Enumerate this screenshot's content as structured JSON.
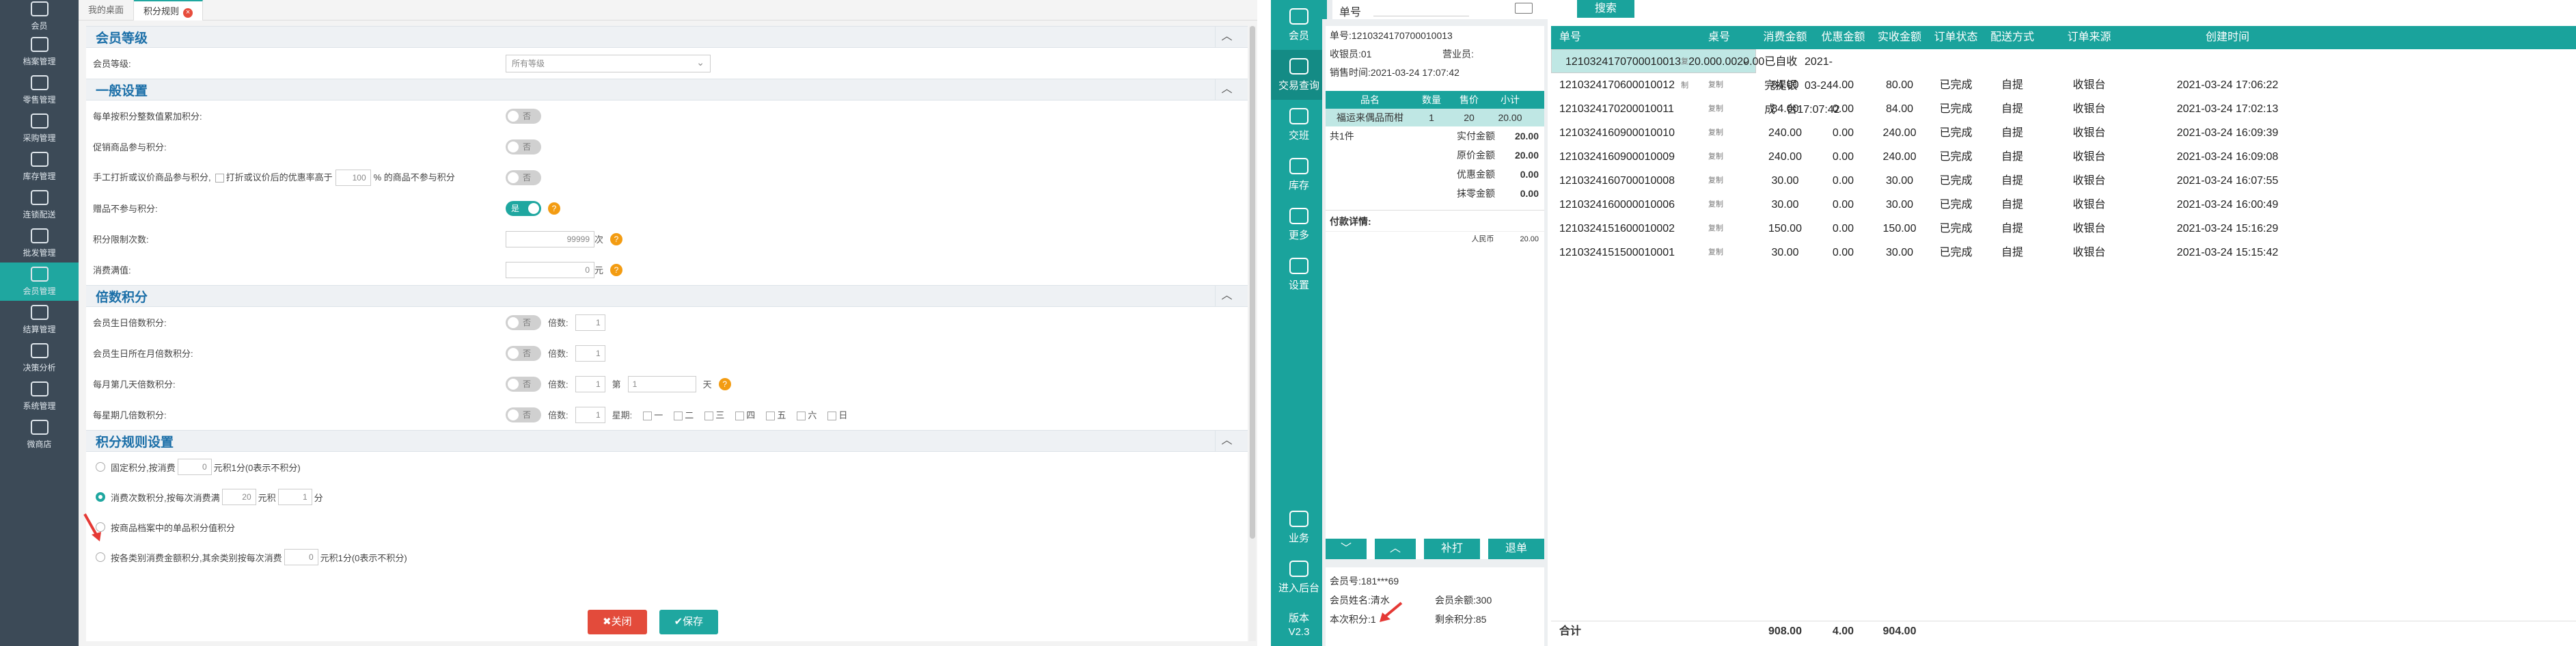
{
  "left_app": {
    "sidebar": [
      {
        "label": "会员",
        "icon": "people-icon"
      },
      {
        "label": "档案管理",
        "icon": "file-icon"
      },
      {
        "label": "零售管理",
        "icon": "shop-icon"
      },
      {
        "label": "采购管理",
        "icon": "cart-icon"
      },
      {
        "label": "库存管理",
        "icon": "box-icon"
      },
      {
        "label": "连锁配送",
        "icon": "truck-icon"
      },
      {
        "label": "批发管理",
        "icon": "wholesale-icon"
      },
      {
        "label": "会员管理",
        "icon": "user-icon",
        "active": true
      },
      {
        "label": "结算管理",
        "icon": "settle-icon"
      },
      {
        "label": "决策分析",
        "icon": "chart-icon"
      },
      {
        "label": "系统管理",
        "icon": "gear-icon"
      },
      {
        "label": "微商店",
        "icon": "store-icon"
      }
    ],
    "tabs": [
      {
        "label": "我的桌面"
      },
      {
        "label": "积分规则",
        "active": true,
        "close": "×"
      }
    ],
    "sections": {
      "member_level": {
        "title": "会员等级",
        "collapse": "︿",
        "level_label": "会员等级:",
        "level_value": "所有等级"
      },
      "general": {
        "title": "一般设置",
        "collapse": "︿",
        "rows": [
          {
            "label": "每单按积分整数值累加积分:",
            "toggle": "否",
            "on": false
          },
          {
            "label": "促销商品参与积分:",
            "toggle": "否",
            "on": false
          },
          {
            "label_a": "手工打折或议价商品参与积分,",
            "label_b": "打折或议价后的优惠率高于",
            "value": "100",
            "label_c": "% 的商品不参与积分",
            "toggle": "否",
            "on": false
          },
          {
            "label": "赠品不参与积分:",
            "toggle": "是",
            "on": true
          },
          {
            "label": "积分限制次数:",
            "value": "99999",
            "unit": "次"
          },
          {
            "label": "消费满值:",
            "value": "0",
            "unit": "元"
          }
        ]
      },
      "multiple": {
        "title": "倍数积分",
        "collapse": "︿",
        "rows": [
          {
            "label": "会员生日倍数积分:",
            "toggle": "否",
            "times_label": "倍数:",
            "times": "1"
          },
          {
            "label": "会员生日所在月倍数积分:",
            "toggle": "否",
            "times_label": "倍数:",
            "times": "1"
          },
          {
            "label": "每月第几天倍数积分:",
            "toggle": "否",
            "times_label": "倍数:",
            "times": "1",
            "day_label": "第",
            "day": "1",
            "day_unit": "天"
          },
          {
            "label": "每星期几倍数积分:",
            "toggle": "否",
            "times_label": "倍数:",
            "times": "1",
            "week_label": "星期:",
            "weekdays": [
              "一",
              "二",
              "三",
              "四",
              "五",
              "六",
              "日"
            ]
          }
        ]
      },
      "rule": {
        "title": "积分规则设置",
        "collapse": "︿",
        "options": [
          {
            "pre": "固定积分,按消费",
            "value": "0",
            "post": "元积1分(0表示不积分)",
            "selected": false
          },
          {
            "pre": "消费次数积分,按每次消费满",
            "value": "20",
            "mid": "元积",
            "value2": "1",
            "post": "分",
            "selected": true
          },
          {
            "pre": "按商品档案中的单品积分值积分",
            "selected": false
          },
          {
            "pre": "按各类别消费金额积分,其余类别按每次消费",
            "value": "0",
            "post": "元积1分(0表示不积分)",
            "selected": false
          }
        ]
      }
    },
    "buttons": {
      "close": "✖关闭",
      "save": "✔保存"
    }
  },
  "right_app": {
    "sidebar": [
      {
        "label": "会员",
        "icon": "member-icon"
      },
      {
        "label": "交易查询",
        "icon": "document-icon",
        "active": true
      },
      {
        "label": "交班",
        "icon": "handover-icon"
      },
      {
        "label": "库存",
        "icon": "warehouse-icon"
      },
      {
        "label": "更多",
        "icon": "grid-icon"
      },
      {
        "label": "设置",
        "icon": "settings-icon"
      }
    ],
    "sidebar_bottom": [
      {
        "label": "业务",
        "icon": "business-icon"
      },
      {
        "label": "进入后台",
        "icon": "monitor-icon"
      }
    ],
    "version_label": "版本",
    "version": "V2.3",
    "search": {
      "label": "单号",
      "button": "搜索"
    },
    "receipt": {
      "order_no": "单号:1210324170700010013",
      "cashier": "收银员:01",
      "clerk": "营业员:",
      "sale_time": "销售时间:2021-03-24 17:07:42",
      "headers": [
        "品名",
        "数量",
        "售价",
        "小计"
      ],
      "items": [
        {
          "name": "福运来偶品而柑",
          "qty": "1",
          "price": "20",
          "subtotal": "20.00"
        }
      ],
      "count": "共1件",
      "summary": [
        {
          "label": "实付金额",
          "value": "20.00"
        },
        {
          "label": "原价金额",
          "value": "20.00"
        },
        {
          "label": "优惠金额",
          "value": "0.00"
        },
        {
          "label": "抹零金额",
          "value": "0.00"
        }
      ],
      "pay_title": "付款详情:",
      "pay_rows": [
        {
          "method": "人民币",
          "amount": "20.00"
        }
      ]
    },
    "nav_buttons": {
      "down": "﹀",
      "up": "︿",
      "reprint": "补打",
      "refund": "退单"
    },
    "member": {
      "no_label": "会员号:",
      "no": "181***69",
      "name_label": "会员姓名:",
      "name": "清水",
      "balance_label": "会员余额:",
      "balance": "300",
      "points_label": "本次积分:",
      "points": "1",
      "remain_label": "剩余积分:",
      "remain": "85"
    },
    "orders": {
      "headers": [
        "单号",
        "桌号",
        "消费金额",
        "优惠金额",
        "实收金额",
        "订单状态",
        "配送方式",
        "订单来源",
        "创建时间"
      ],
      "copy_label": "复制",
      "rows": [
        {
          "no": "1210324170700010013",
          "amount": "20.00",
          "discount": "0.00",
          "received": "20.00",
          "status": "已完成",
          "delivery": "自提",
          "source": "收银台",
          "time": "2021-03-24 17:07:42",
          "selected": true
        },
        {
          "no": "1210324170600010012",
          "amount": "84.00",
          "discount": "4.00",
          "received": "80.00",
          "status": "已完成",
          "delivery": "自提",
          "source": "收银台",
          "time": "2021-03-24 17:06:22"
        },
        {
          "no": "1210324170200010011",
          "amount": "84.00",
          "discount": "0.00",
          "received": "84.00",
          "status": "已完成",
          "delivery": "自提",
          "source": "收银台",
          "time": "2021-03-24 17:02:13"
        },
        {
          "no": "1210324160900010010",
          "amount": "240.00",
          "discount": "0.00",
          "received": "240.00",
          "status": "已完成",
          "delivery": "自提",
          "source": "收银台",
          "time": "2021-03-24 16:09:39"
        },
        {
          "no": "1210324160900010009",
          "amount": "240.00",
          "discount": "0.00",
          "received": "240.00",
          "status": "已完成",
          "delivery": "自提",
          "source": "收银台",
          "time": "2021-03-24 16:09:08"
        },
        {
          "no": "1210324160700010008",
          "amount": "30.00",
          "discount": "0.00",
          "received": "30.00",
          "status": "已完成",
          "delivery": "自提",
          "source": "收银台",
          "time": "2021-03-24 16:07:55"
        },
        {
          "no": "1210324160000010006",
          "amount": "30.00",
          "discount": "0.00",
          "received": "30.00",
          "status": "已完成",
          "delivery": "自提",
          "source": "收银台",
          "time": "2021-03-24 16:00:49"
        },
        {
          "no": "1210324151600010002",
          "amount": "150.00",
          "discount": "0.00",
          "received": "150.00",
          "status": "已完成",
          "delivery": "自提",
          "source": "收银台",
          "time": "2021-03-24 15:16:29"
        },
        {
          "no": "1210324151500010001",
          "amount": "30.00",
          "discount": "0.00",
          "received": "30.00",
          "status": "已完成",
          "delivery": "自提",
          "source": "收银台",
          "time": "2021-03-24 15:15:42"
        }
      ],
      "total_label": "合计",
      "total_amount": "908.00",
      "total_discount": "4.00",
      "total_received": "904.00"
    }
  },
  "colors": {
    "teal": "#1aa39c",
    "sidebar_dark": "#3c4a57",
    "section_title": "#1b6fa8",
    "close_red": "#e34b3b",
    "help_orange": "#f39c12",
    "selected_row": "#bfe7e4"
  }
}
